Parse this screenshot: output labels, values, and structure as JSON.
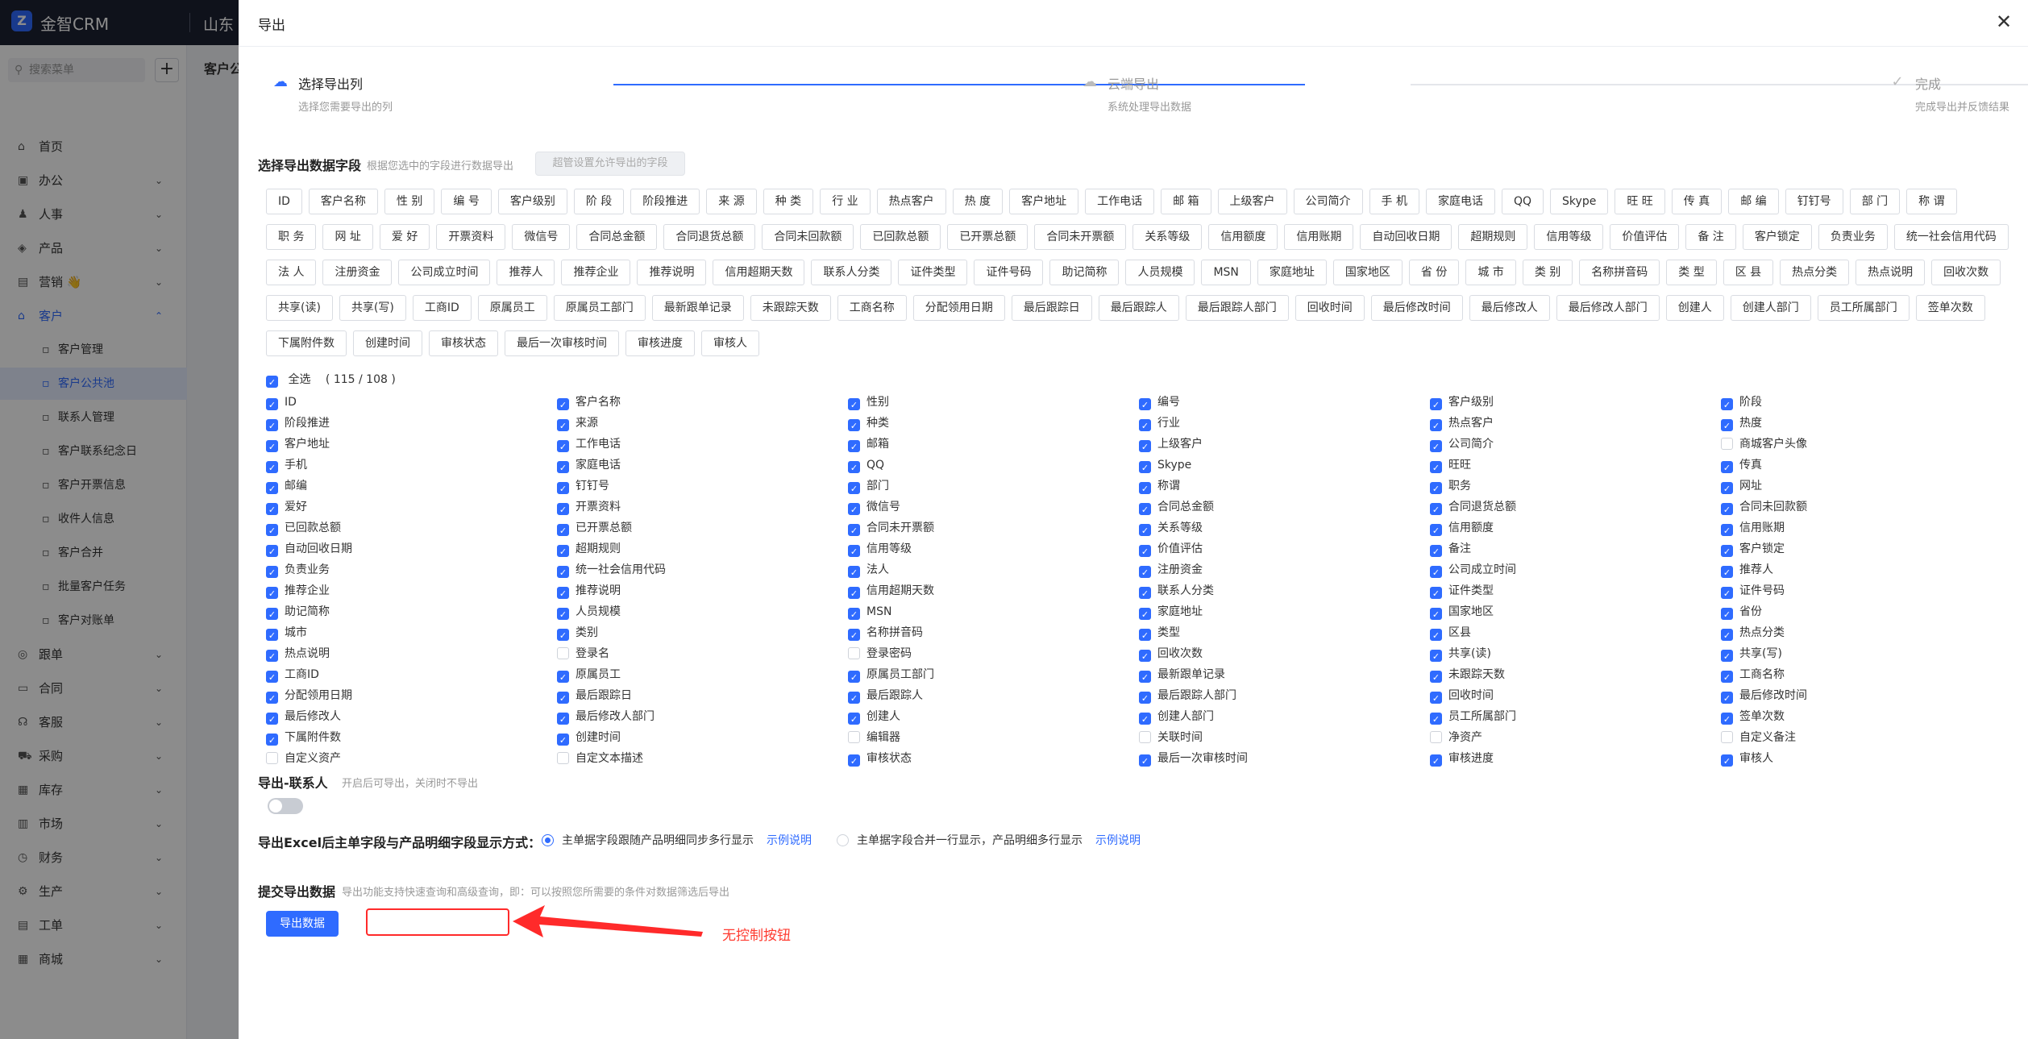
{
  "app": {
    "logo": "Z",
    "name": "金智CRM",
    "company": "山东",
    "menu_search_placeholder": "搜索菜单",
    "add": "+",
    "content_title": "客户公",
    "nav": [
      {
        "icon": "home-icon",
        "glyph": "⌂",
        "label": "首页",
        "chev": ""
      },
      {
        "icon": "office-icon",
        "glyph": "▣",
        "label": "办公",
        "chev": "⌄"
      },
      {
        "icon": "people-icon",
        "glyph": "♟",
        "label": "人事",
        "chev": "⌄"
      },
      {
        "icon": "product-icon",
        "glyph": "◈",
        "label": "产品",
        "chev": "⌄"
      },
      {
        "icon": "marketing-icon",
        "glyph": "▤",
        "label": "营销 👋",
        "chev": "⌄"
      },
      {
        "icon": "customer-icon",
        "glyph": "⌂",
        "label": "客户",
        "chev": "⌃"
      }
    ],
    "sub_nav": [
      {
        "label": "客户管理"
      },
      {
        "label": "客户公共池"
      },
      {
        "label": "联系人管理"
      },
      {
        "label": "客户联系纪念日"
      },
      {
        "label": "客户开票信息"
      },
      {
        "label": "收件人信息"
      },
      {
        "label": "客户合并"
      },
      {
        "label": "批量客户任务"
      },
      {
        "label": "客户对账单"
      }
    ],
    "nav2": [
      {
        "icon": "order-icon",
        "glyph": "◎",
        "label": "跟单",
        "chev": "⌄"
      },
      {
        "icon": "contract-icon",
        "glyph": "▭",
        "label": "合同",
        "chev": "⌄"
      },
      {
        "icon": "service-icon",
        "glyph": "☊",
        "label": "客服",
        "chev": "⌄"
      },
      {
        "icon": "purchase-icon",
        "glyph": "⛟",
        "label": "采购",
        "chev": "⌄"
      },
      {
        "icon": "stock-icon",
        "glyph": "▦",
        "label": "库存",
        "chev": "⌄"
      },
      {
        "icon": "market-icon",
        "glyph": "▥",
        "label": "市场",
        "chev": "⌄"
      },
      {
        "icon": "finance-icon",
        "glyph": "◷",
        "label": "财务",
        "chev": "⌄"
      },
      {
        "icon": "production-icon",
        "glyph": "⚙",
        "label": "生产",
        "chev": "⌄"
      },
      {
        "icon": "work-order-icon",
        "glyph": "▤",
        "label": "工单",
        "chev": "⌄"
      },
      {
        "icon": "mall-icon",
        "glyph": "▦",
        "label": "商城",
        "chev": "⌄"
      }
    ],
    "bottom_tools": [
      "◷",
      "⇅",
      "☰"
    ]
  },
  "drawer": {
    "title": "导出",
    "close": "✕",
    "steps": [
      {
        "title": "选择导出列",
        "desc": "选择您需要导出的列",
        "glyph": "☁"
      },
      {
        "title": "云端导出",
        "desc": "系统处理导出数据",
        "glyph": "☁"
      },
      {
        "title": "完成",
        "desc": "完成导出并反馈结果",
        "glyph": "✓"
      }
    ],
    "field_section": {
      "title": "选择导出数据字段",
      "hint": "根据您选中的字段进行数据导出",
      "settings_button": "超管设置允许导出的字段"
    },
    "tags": [
      "ID",
      "客户名称",
      "性 别",
      "编 号",
      "客户级别",
      "阶 段",
      "阶段推进",
      "来 源",
      "种 类",
      "行 业",
      "热点客户",
      "热 度",
      "客户地址",
      "工作电话",
      "邮 箱",
      "上级客户",
      "公司简介",
      "手 机",
      "家庭电话",
      "QQ",
      "Skype",
      "旺 旺",
      "传 真",
      "邮 编",
      "钉钉号",
      "部 门",
      "称 谓",
      "职 务",
      "网 址",
      "爱 好",
      "开票资料",
      "微信号",
      "合同总金额",
      "合同退货总额",
      "合同未回款额",
      "已回款总额",
      "已开票总额",
      "合同未开票额",
      "关系等级",
      "信用额度",
      "信用账期",
      "自动回收日期",
      "超期规则",
      "信用等级",
      "价值评估",
      "备 注",
      "客户锁定",
      "负责业务",
      "统一社会信用代码",
      "法 人",
      "注册资金",
      "公司成立时间",
      "推荐人",
      "推荐企业",
      "推荐说明",
      "信用超期天数",
      "联系人分类",
      "证件类型",
      "证件号码",
      "助记简称",
      "人员规模",
      "MSN",
      "家庭地址",
      "国家地区",
      "省 份",
      "城 市",
      "类 别",
      "名称拼音码",
      "类 型",
      "区 县",
      "热点分类",
      "热点说明",
      "回收次数",
      "共享(读)",
      "共享(写)",
      "工商ID",
      "原属员工",
      "原属员工部门",
      "最新跟单记录",
      "未跟踪天数",
      "工商名称",
      "分配领用日期",
      "最后跟踪日",
      "最后跟踪人",
      "最后跟踪人部门",
      "回收时间",
      "最后修改时间",
      "最后修改人",
      "最后修改人部门",
      "创建人",
      "创建人部门",
      "员工所属部门",
      "签单次数",
      "下属附件数",
      "创建时间",
      "审核状态",
      "最后一次审核时间",
      "审核进度",
      "审核人"
    ],
    "select_all": {
      "label": "全选",
      "count": "( 115 / 108 )"
    },
    "checkbox_rows": [
      [
        {
          "l": "ID",
          "c": true
        },
        {
          "l": "客户名称",
          "c": true
        },
        {
          "l": "性别",
          "c": true
        },
        {
          "l": "编号",
          "c": true
        },
        {
          "l": "客户级别",
          "c": true
        },
        {
          "l": "阶段",
          "c": true
        }
      ],
      [
        {
          "l": "阶段推进",
          "c": true
        },
        {
          "l": "来源",
          "c": true
        },
        {
          "l": "种类",
          "c": true
        },
        {
          "l": "行业",
          "c": true
        },
        {
          "l": "热点客户",
          "c": true
        },
        {
          "l": "热度",
          "c": true
        }
      ],
      [
        {
          "l": "客户地址",
          "c": true
        },
        {
          "l": "工作电话",
          "c": true
        },
        {
          "l": "邮箱",
          "c": true
        },
        {
          "l": "上级客户",
          "c": true
        },
        {
          "l": "公司简介",
          "c": true
        },
        {
          "l": "商城客户头像",
          "c": false
        }
      ],
      [
        {
          "l": "手机",
          "c": true
        },
        {
          "l": "家庭电话",
          "c": true
        },
        {
          "l": "QQ",
          "c": true
        },
        {
          "l": "Skype",
          "c": true
        },
        {
          "l": "旺旺",
          "c": true
        },
        {
          "l": "传真",
          "c": true
        }
      ],
      [
        {
          "l": "邮编",
          "c": true
        },
        {
          "l": "钉钉号",
          "c": true
        },
        {
          "l": "部门",
          "c": true
        },
        {
          "l": "称谓",
          "c": true
        },
        {
          "l": "职务",
          "c": true
        },
        {
          "l": "网址",
          "c": true
        }
      ],
      [
        {
          "l": "爱好",
          "c": true
        },
        {
          "l": "开票资料",
          "c": true
        },
        {
          "l": "微信号",
          "c": true
        },
        {
          "l": "合同总金额",
          "c": true
        },
        {
          "l": "合同退货总额",
          "c": true
        },
        {
          "l": "合同未回款额",
          "c": true
        }
      ],
      [
        {
          "l": "已回款总额",
          "c": true
        },
        {
          "l": "已开票总额",
          "c": true
        },
        {
          "l": "合同未开票额",
          "c": true
        },
        {
          "l": "关系等级",
          "c": true
        },
        {
          "l": "信用额度",
          "c": true
        },
        {
          "l": "信用账期",
          "c": true
        }
      ],
      [
        {
          "l": "自动回收日期",
          "c": true
        },
        {
          "l": "超期规则",
          "c": true
        },
        {
          "l": "信用等级",
          "c": true
        },
        {
          "l": "价值评估",
          "c": true
        },
        {
          "l": "备注",
          "c": true
        },
        {
          "l": "客户锁定",
          "c": true
        }
      ],
      [
        {
          "l": "负责业务",
          "c": true
        },
        {
          "l": "统一社会信用代码",
          "c": true
        },
        {
          "l": "法人",
          "c": true
        },
        {
          "l": "注册资金",
          "c": true
        },
        {
          "l": "公司成立时间",
          "c": true
        },
        {
          "l": "推荐人",
          "c": true
        }
      ],
      [
        {
          "l": "推荐企业",
          "c": true
        },
        {
          "l": "推荐说明",
          "c": true
        },
        {
          "l": "信用超期天数",
          "c": true
        },
        {
          "l": "联系人分类",
          "c": true
        },
        {
          "l": "证件类型",
          "c": true
        },
        {
          "l": "证件号码",
          "c": true
        }
      ],
      [
        {
          "l": "助记简称",
          "c": true
        },
        {
          "l": "人员规模",
          "c": true
        },
        {
          "l": "MSN",
          "c": true
        },
        {
          "l": "家庭地址",
          "c": true
        },
        {
          "l": "国家地区",
          "c": true
        },
        {
          "l": "省份",
          "c": true
        }
      ],
      [
        {
          "l": "城市",
          "c": true
        },
        {
          "l": "类别",
          "c": true
        },
        {
          "l": "名称拼音码",
          "c": true
        },
        {
          "l": "类型",
          "c": true
        },
        {
          "l": "区县",
          "c": true
        },
        {
          "l": "热点分类",
          "c": true
        }
      ],
      [
        {
          "l": "热点说明",
          "c": true
        },
        {
          "l": "登录名",
          "c": false
        },
        {
          "l": "登录密码",
          "c": false
        },
        {
          "l": "回收次数",
          "c": true
        },
        {
          "l": "共享(读)",
          "c": true
        },
        {
          "l": "共享(写)",
          "c": true
        }
      ],
      [
        {
          "l": "工商ID",
          "c": true
        },
        {
          "l": "原属员工",
          "c": true
        },
        {
          "l": "原属员工部门",
          "c": true
        },
        {
          "l": "最新跟单记录",
          "c": true
        },
        {
          "l": "未跟踪天数",
          "c": true
        },
        {
          "l": "工商名称",
          "c": true
        }
      ],
      [
        {
          "l": "分配领用日期",
          "c": true
        },
        {
          "l": "最后跟踪日",
          "c": true
        },
        {
          "l": "最后跟踪人",
          "c": true
        },
        {
          "l": "最后跟踪人部门",
          "c": true
        },
        {
          "l": "回收时间",
          "c": true
        },
        {
          "l": "最后修改时间",
          "c": true
        }
      ],
      [
        {
          "l": "最后修改人",
          "c": true
        },
        {
          "l": "最后修改人部门",
          "c": true
        },
        {
          "l": "创建人",
          "c": true
        },
        {
          "l": "创建人部门",
          "c": true
        },
        {
          "l": "员工所属部门",
          "c": true
        },
        {
          "l": "签单次数",
          "c": true
        }
      ],
      [
        {
          "l": "下属附件数",
          "c": true
        },
        {
          "l": "创建时间",
          "c": true
        },
        {
          "l": "编辑器",
          "c": false
        },
        {
          "l": "关联时间",
          "c": false
        },
        {
          "l": "净资产",
          "c": false
        },
        {
          "l": "自定义备注",
          "c": false
        }
      ],
      [
        {
          "l": "自定义资产",
          "c": false
        },
        {
          "l": "自定文本描述",
          "c": false
        },
        {
          "l": "审核状态",
          "c": true
        },
        {
          "l": "最后一次审核时间",
          "c": true
        },
        {
          "l": "审核进度",
          "c": true
        },
        {
          "l": "审核人",
          "c": true
        }
      ]
    ],
    "contact": {
      "title": "导出-联系人",
      "hint": "开启后可导出，关闭时不导出",
      "enabled": false
    },
    "excel_mode": {
      "title": "导出Excel后主单字段与产品明细字段显示方式：",
      "options": [
        {
          "label": "主单据字段跟随产品明细同步多行显示",
          "link": "示例说明",
          "selected": true
        },
        {
          "label": "主单据字段合并一行显示，产品明细多行显示",
          "link": "示例说明",
          "selected": false
        }
      ]
    },
    "submit": {
      "title": "提交导出数据",
      "hint": "导出功能支持快速查询和高级查询，即：可以按照您所需要的条件对数据筛选后导出",
      "button": "导出数据"
    },
    "annotation": {
      "text": "无控制按钮",
      "color": "#ff3b30"
    }
  },
  "colors": {
    "accent": "#2f6bff",
    "annotation": "#ff2a2a",
    "topbar": "#1d2132"
  }
}
